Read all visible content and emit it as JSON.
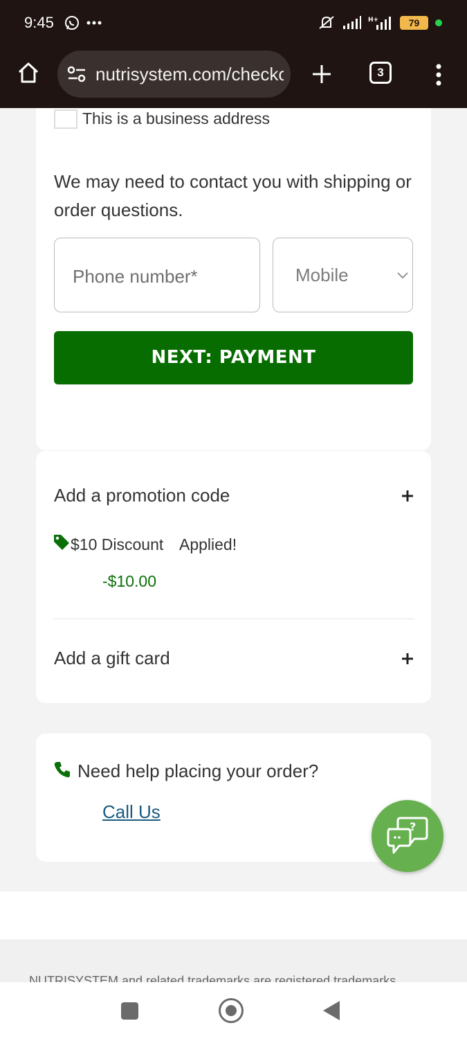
{
  "status_bar": {
    "time": "9:45",
    "battery": "79",
    "icons": [
      "whatsapp-icon",
      "more-dots-icon",
      "mute-icon",
      "signal-icon",
      "hplus-signal-icon",
      "battery-icon",
      "active-dot-icon"
    ]
  },
  "browser": {
    "url": "nutrisystem.com/checkout",
    "tab_count": "3"
  },
  "shipping": {
    "business_checkbox_label": "This is a business address",
    "contact_text": "We may need to contact you with shipping or order questions.",
    "phone_placeholder": "Phone number*",
    "phone_type": "Mobile",
    "next_button": "NEXT: PAYMENT"
  },
  "promotions": {
    "promo_label": "Add a promotion code",
    "discount_name": "$10 Discount",
    "discount_status": "Applied!",
    "discount_amount": "-$10.00",
    "gift_card_label": "Add a gift card"
  },
  "help": {
    "text": "Need help placing your order?",
    "link": "Call Us"
  },
  "footer": {
    "text": "NUTRISYSTEM and related trademarks are registered trademarks"
  },
  "colors": {
    "primary_green": "#086d00",
    "chat_green": "#67b04f",
    "discount_green": "#0b6f08",
    "link_blue": "#1a5a80",
    "browser_bar": "#1f1411"
  }
}
